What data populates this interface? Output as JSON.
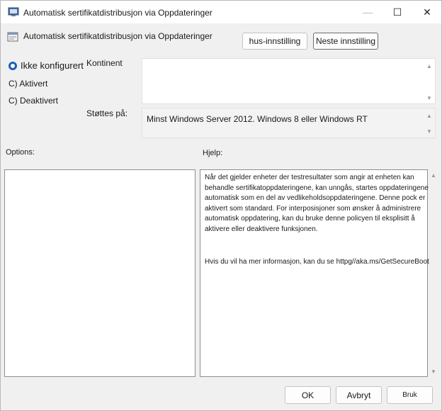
{
  "window": {
    "title": "Automatisk sertifikatdistribusjon via Oppdateringer",
    "controls": {
      "minimize": "—",
      "maximize": "☐",
      "close": "✕"
    }
  },
  "header": {
    "title": "Automatisk sertifikatdistribusjon via Oppdateringer",
    "prev_setting": "hus-innstilling",
    "next_setting": "Neste innstilling"
  },
  "state": {
    "not_configured": "Ikke konfigurert",
    "enabled": "C) Aktivert",
    "disabled": "C) Deaktivert",
    "selected": "not_configured"
  },
  "comment": {
    "label": "Kontinent",
    "value": ""
  },
  "supported": {
    "label": "Støttes på:",
    "value": "Minst Windows Server 2012. Windows 8 eller Windows RT"
  },
  "options": {
    "label": "Options:"
  },
  "help": {
    "label": "Hjelp:",
    "paragraph1": "Når det gjelder enheter der testresultater som angir at enheten kan behandle sertifikatoppdateringene, kan unngås, startes oppdateringene automatisk som en del av vedlikeholdsoppdateringene. Denne pock er aktivert som standard. For interposisjoner som ønsker å administrere automatisk oppdatering, kan du bruke denne policyen til eksplisitt å aktivere eller deaktivere funksjonen.",
    "paragraph2": "Hvis du vil ha mer informasjon, kan du se httpg//aka.ms/GetSecureBoot"
  },
  "footer": {
    "ok": "OK",
    "cancel": "Avbryt",
    "apply": "Bruk"
  }
}
